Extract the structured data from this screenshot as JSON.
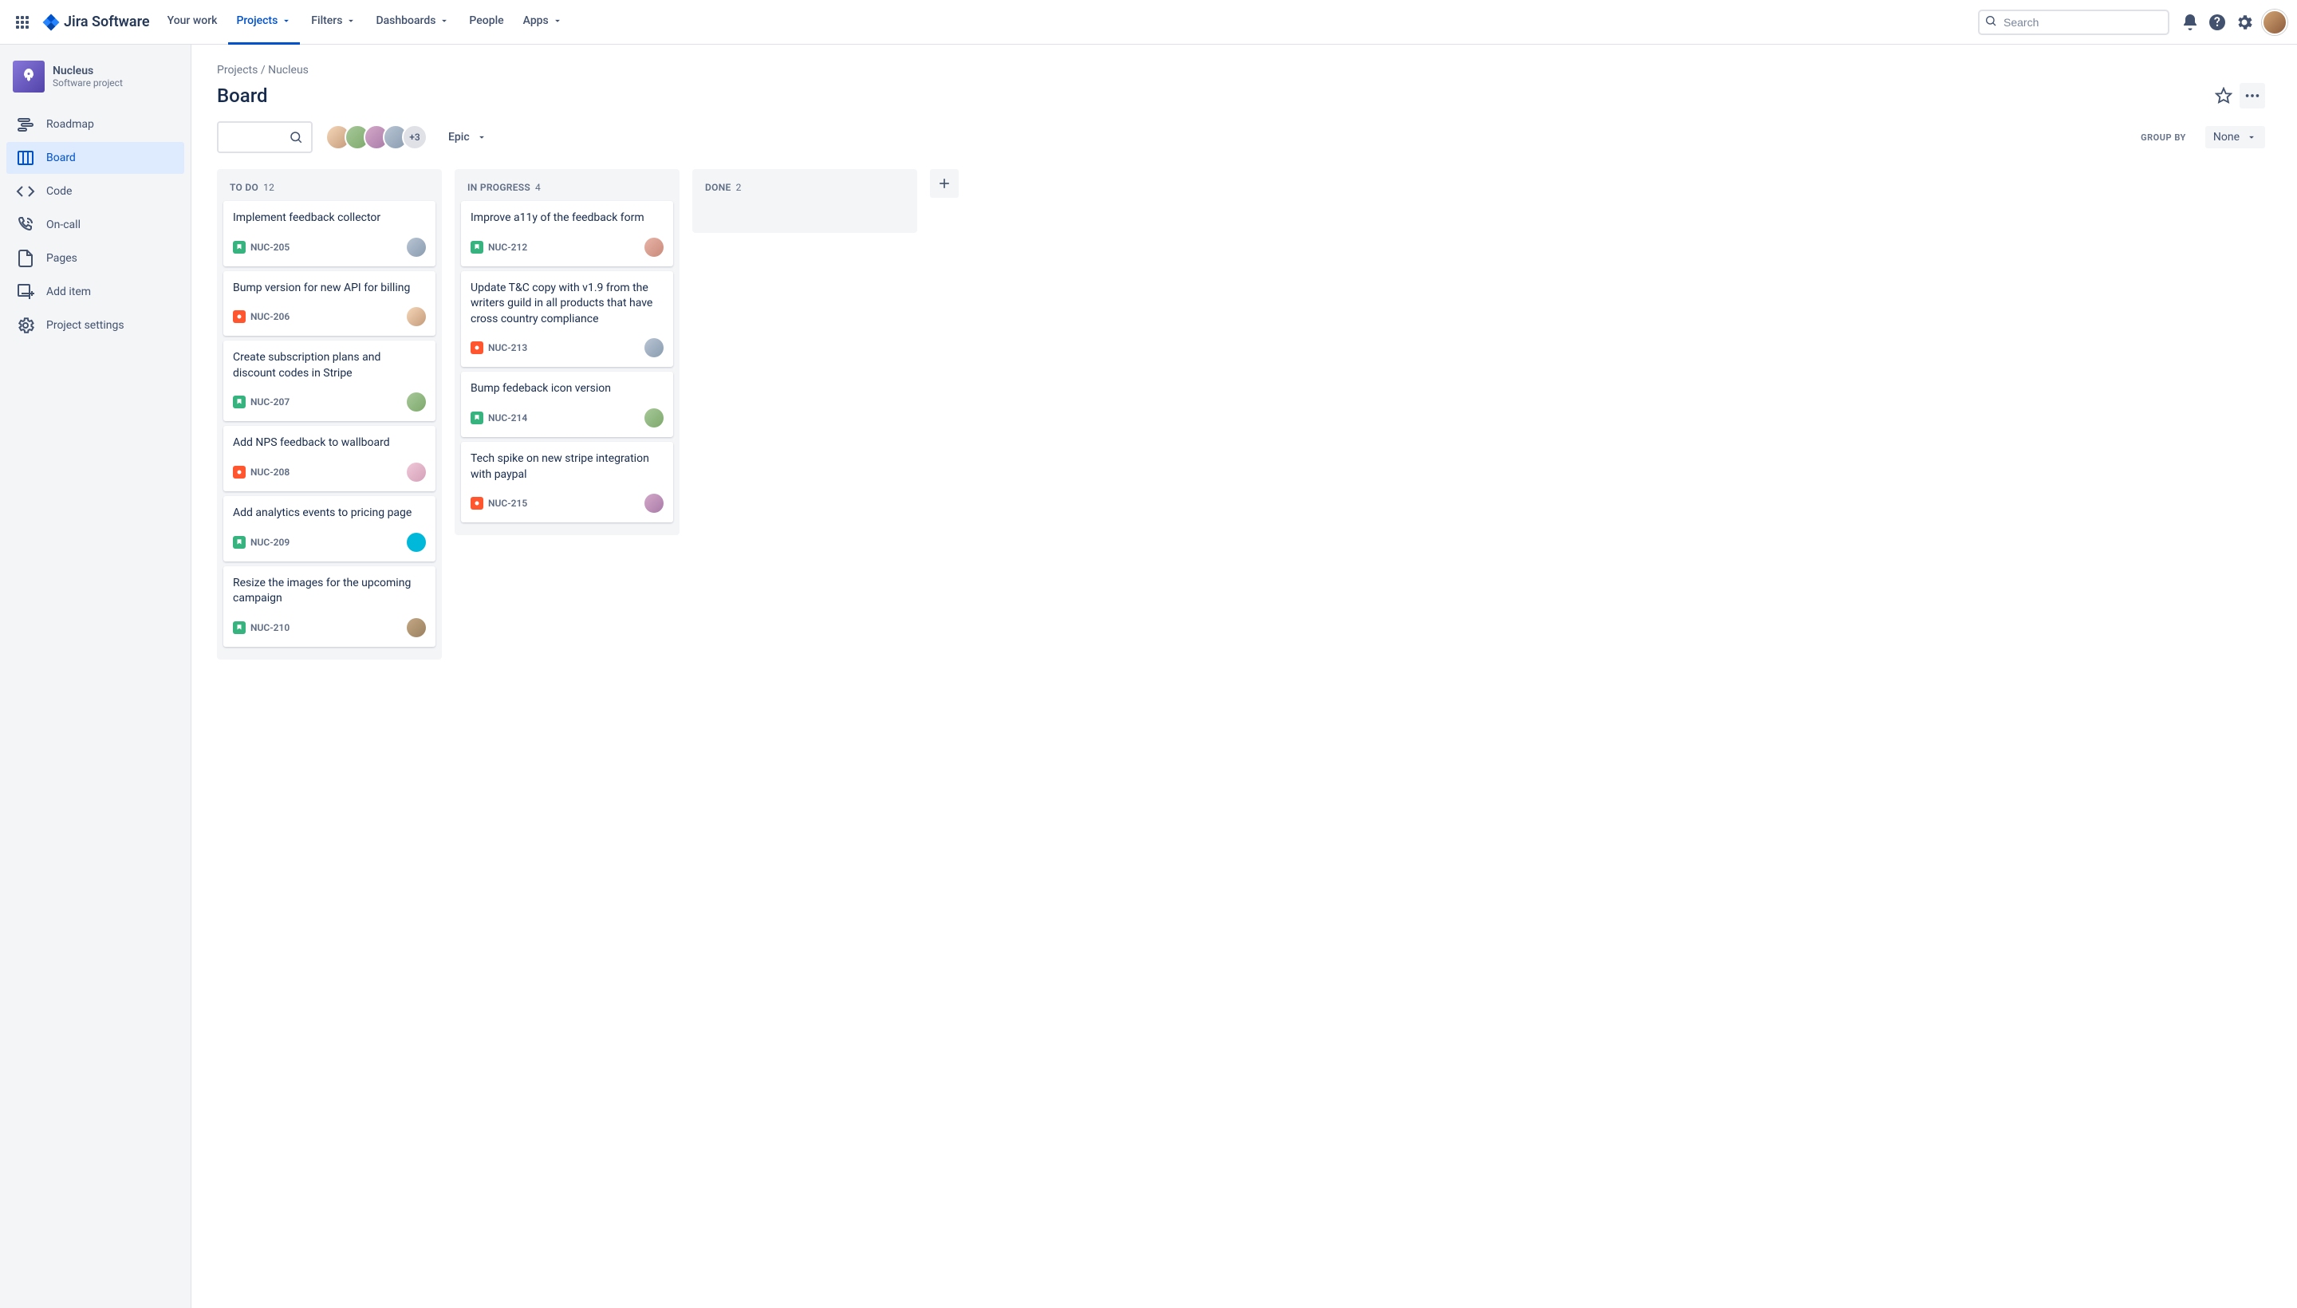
{
  "nav": {
    "logo_text": "Jira Software",
    "items": [
      "Your work",
      "Projects",
      "Filters",
      "Dashboards",
      "People",
      "Apps"
    ],
    "active_index": 1,
    "has_dropdown": [
      false,
      true,
      true,
      true,
      false,
      true
    ],
    "search_placeholder": "Search"
  },
  "sidebar": {
    "project_name": "Nucleus",
    "project_type": "Software project",
    "items": [
      {
        "label": "Roadmap",
        "icon": "roadmap-icon"
      },
      {
        "label": "Board",
        "icon": "board-icon"
      },
      {
        "label": "Code",
        "icon": "code-icon"
      },
      {
        "label": "On-call",
        "icon": "oncall-icon"
      },
      {
        "label": "Pages",
        "icon": "pages-icon"
      },
      {
        "label": "Add item",
        "icon": "additem-icon"
      },
      {
        "label": "Project settings",
        "icon": "settings-icon"
      }
    ],
    "active_index": 1
  },
  "breadcrumb": {
    "parent": "Projects",
    "current": "Nucleus"
  },
  "page_title": "Board",
  "toolbar": {
    "epic_label": "Epic",
    "avatar_more": "+3",
    "groupby_label": "GROUP BY",
    "groupby_value": "None"
  },
  "columns": [
    {
      "name": "TO DO",
      "count": "12",
      "cards": [
        {
          "title": "Implement feedback collector",
          "key": "NUC-205",
          "type": "story",
          "avatar": "avc4"
        },
        {
          "title": "Bump version for new API for billing",
          "key": "NUC-206",
          "type": "bug",
          "avatar": "avc1"
        },
        {
          "title": "Create subscription plans and discount codes in Stripe",
          "key": "NUC-207",
          "type": "story",
          "avatar": "avc2"
        },
        {
          "title": "Add NPS feedback to wallboard",
          "key": "NUC-208",
          "type": "bug",
          "avatar": "avc6"
        },
        {
          "title": "Add analytics events to pricing page",
          "key": "NUC-209",
          "type": "story",
          "avatar": "avc7"
        },
        {
          "title": "Resize the images for the upcoming campaign",
          "key": "NUC-210",
          "type": "story",
          "avatar": "avc8"
        }
      ]
    },
    {
      "name": "IN PROGRESS",
      "count": "4",
      "cards": [
        {
          "title": "Improve a11y of the feedback form",
          "key": "NUC-212",
          "type": "story",
          "avatar": "avc5"
        },
        {
          "title": "Update T&C copy with v1.9 from the writers guild in all products that have cross country compliance",
          "key": "NUC-213",
          "type": "bug",
          "avatar": "avc4"
        },
        {
          "title": "Bump fedeback icon version",
          "key": "NUC-214",
          "type": "story",
          "avatar": "avc2"
        },
        {
          "title": "Tech spike on new stripe integration with paypal",
          "key": "NUC-215",
          "type": "bug",
          "avatar": "avc3"
        }
      ]
    },
    {
      "name": "DONE",
      "count": "2",
      "cards": []
    }
  ]
}
